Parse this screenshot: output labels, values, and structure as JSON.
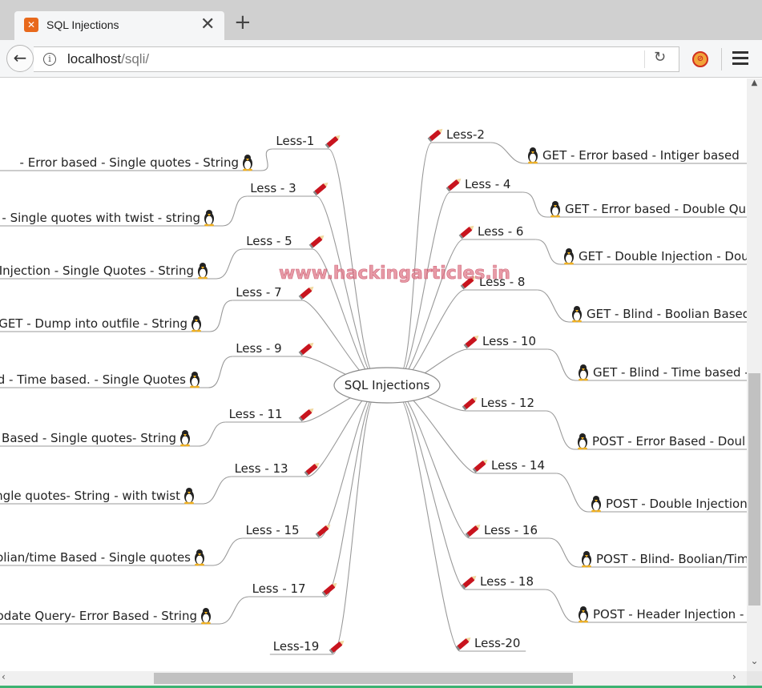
{
  "tab": {
    "title": "SQL Injections",
    "favicon": "xampp-icon"
  },
  "address": {
    "host": "localhost",
    "path": "/sqli/"
  },
  "watermark": "www.hackingarticles.in",
  "center": "SQL Injections",
  "left_lessons": [
    {
      "less": "Less-1",
      "title": "- Error based - Single quotes - String"
    },
    {
      "less": "Less - 3",
      "title": "d - Single quotes with twist - string"
    },
    {
      "less": "Less - 5",
      "title": "Injection - Single Quotes - String"
    },
    {
      "less": "Less - 7",
      "title": "GET - Dump into outfile - String"
    },
    {
      "less": "Less - 9",
      "title": "d - Time based. -  Single Quotes"
    },
    {
      "less": "Less - 11",
      "title": "Based - Single quotes- String"
    },
    {
      "less": "Less - 13",
      "title": "ngle quotes- String - with twist"
    },
    {
      "less": "Less - 15",
      "title": "olian/time Based - Single quotes"
    },
    {
      "less": "Less - 17",
      "title": "odate Query- Error Based - String"
    },
    {
      "less": "Less-19",
      "title": ""
    }
  ],
  "right_lessons": [
    {
      "less": "Less-2",
      "title": "GET - Error based - Intiger based"
    },
    {
      "less": "Less - 4",
      "title": "GET - Error based - Double Qu"
    },
    {
      "less": "Less - 6",
      "title": "GET - Double Injection - Dou"
    },
    {
      "less": "Less - 8",
      "title": "GET - Blind - Boolian Based"
    },
    {
      "less": "Less - 10",
      "title": "GET - Blind - Time based -"
    },
    {
      "less": "Less - 12",
      "title": "POST - Error Based - Doul"
    },
    {
      "less": "Less - 14",
      "title": "POST - Double Injection"
    },
    {
      "less": "Less - 16",
      "title": "POST - Blind- Boolian/Tim"
    },
    {
      "less": "Less - 18",
      "title": "POST - Header Injection -"
    },
    {
      "less": "Less-20",
      "title": ""
    }
  ],
  "colors": {
    "tab_favicon": "#e8691c",
    "pencil": "#c8141e",
    "watermark": "#e07a8a",
    "status_line": "#3cb371"
  }
}
